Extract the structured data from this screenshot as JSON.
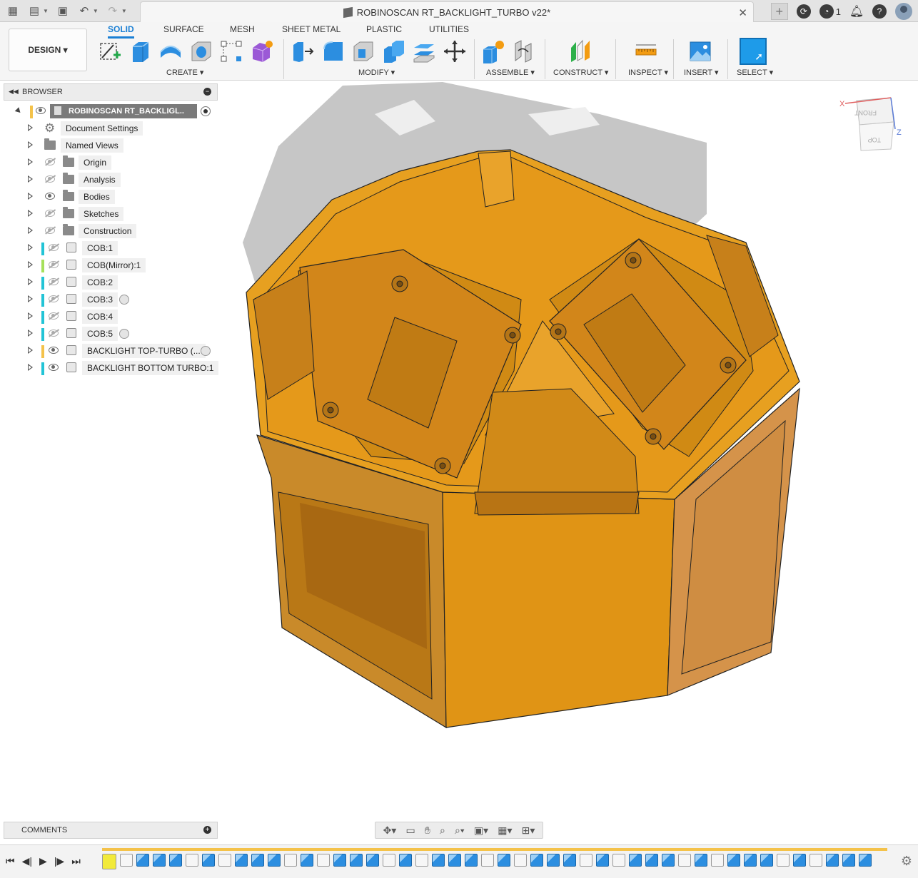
{
  "window": {
    "doc_title": "ROBINOSCAN RT_BACKLIGHT_TURBO v22*",
    "jobs_count": "1"
  },
  "toolbar": {
    "workspace": "DESIGN ▾",
    "tabs": [
      "SOLID",
      "SURFACE",
      "MESH",
      "SHEET METAL",
      "PLASTIC",
      "UTILITIES"
    ],
    "active_tab": "SOLID",
    "groups": {
      "create": "CREATE ▾",
      "modify": "MODIFY ▾",
      "assemble": "ASSEMBLE ▾",
      "construct": "CONSTRUCT ▾",
      "inspect": "INSPECT ▾",
      "insert": "INSERT ▾",
      "select": "SELECT ▾"
    }
  },
  "browser": {
    "title": "BROWSER",
    "root": "ROBINOSCAN RT_BACKLIGL..",
    "items": [
      {
        "label": "Document Settings"
      },
      {
        "label": "Named Views"
      },
      {
        "label": "Origin"
      },
      {
        "label": "Analysis"
      },
      {
        "label": "Bodies"
      },
      {
        "label": "Sketches"
      },
      {
        "label": "Construction"
      },
      {
        "label": "COB:1"
      },
      {
        "label": "COB(Mirror):1"
      },
      {
        "label": "COB:2"
      },
      {
        "label": "COB:3"
      },
      {
        "label": "COB:4"
      },
      {
        "label": "COB:5"
      },
      {
        "label": "BACKLIGHT TOP-TURBO (..."
      },
      {
        "label": "BACKLIGHT BOTTOM TURBO:1"
      }
    ]
  },
  "viewcube": {
    "front": "FRONT",
    "top": "TOP",
    "x": "X",
    "z": "Z"
  },
  "comments": {
    "title": "COMMENTS"
  },
  "colors": {
    "accent": "#1a7fd4",
    "body": "#e29a1b",
    "cob_bar": "#22c4d6",
    "cob_mirror_bar": "#a6e05a",
    "backlight_bar": "#f4c24a"
  }
}
